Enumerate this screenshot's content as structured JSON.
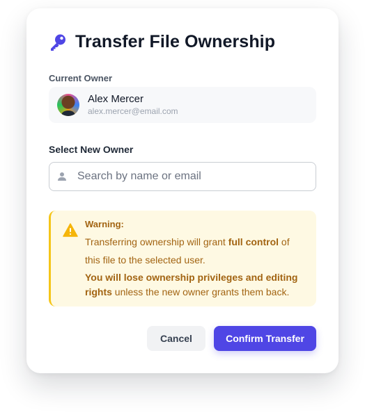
{
  "dialog": {
    "title": "Transfer File Ownership",
    "icon": "key-icon",
    "accent_color": "#4f46e5"
  },
  "current_owner": {
    "label": "Current Owner",
    "name": "Alex Mercer",
    "email": "alex.mercer@email.com"
  },
  "new_owner": {
    "label": "Select New Owner",
    "search_placeholder": "Search by name or email",
    "search_value": ""
  },
  "warning": {
    "title": "Warning:",
    "line1_prefix": "Transferring ownership will grant ",
    "line1_bold": "full control",
    "line1_suffix": " of",
    "line2": "this file to the selected user.",
    "strong_text": "You will lose ownership privileges and editing rights",
    "tail": " unless the new owner grants them back.",
    "color": "#a26412",
    "background": "#fef9e3",
    "border_color": "#f5c518"
  },
  "actions": {
    "cancel_label": "Cancel",
    "confirm_label": "Confirm Transfer"
  }
}
